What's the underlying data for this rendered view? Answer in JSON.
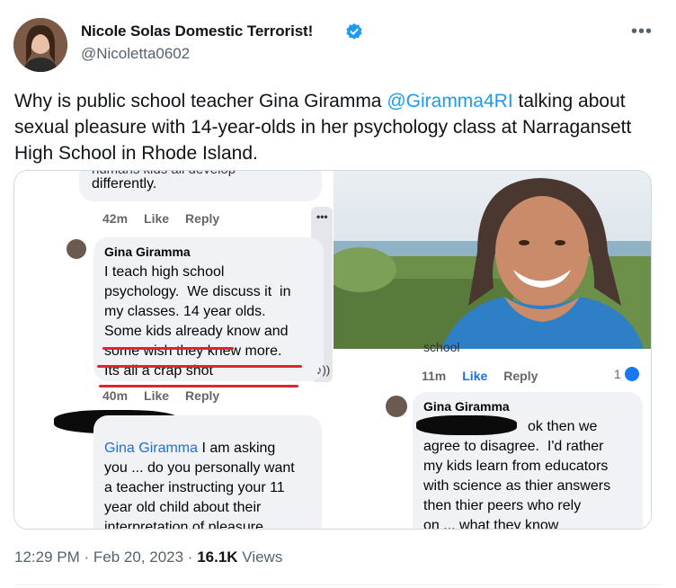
{
  "author": {
    "name": "Nicole Solas Domestic Terrorist!",
    "handle": "@Nicoletta0602"
  },
  "more_label": "•••",
  "tweet": {
    "text_before": "Why is public school teacher Gina Giramma ",
    "mention": "@Giramma4RI",
    "text_after": " talking about sexual pleasure with 14-year-olds in her psychology class at Narragansett High School in Rhode Island."
  },
  "media": {
    "left": {
      "top_partial_line1": "humans kids all develop",
      "top_partial_line2": "differently.",
      "meta1": {
        "time": "42m",
        "like": "Like",
        "reply": "Reply"
      },
      "comment_author": "Gina Giramma",
      "comment_lines": [
        "I teach high school",
        "psychology.  We discuss it  in",
        "my classes. 14 year olds.",
        "Some kids already know and",
        "some wish they knew more.",
        "Its all a crap shot"
      ],
      "meta2": {
        "time": "40m",
        "like": "Like",
        "reply": "Reply"
      },
      "reply_mention": "Gina Giramma",
      "reply_lines": [
        " I am asking",
        "you ... do you personally want",
        "a teacher instructing your 11",
        "year old child about their",
        "interpretation of pleasure"
      ],
      "audio_icon_text": "♪))"
    },
    "right": {
      "partial_top": "school",
      "meta": {
        "time": "11m",
        "like": "Like",
        "reply": "Reply",
        "reaction_count": "1"
      },
      "comment_author": "Gina Giramma",
      "comment_lines": [
        "ok then we",
        "agree to disagree.  I'd rather",
        "my kids learn from educators",
        "with science as thier answers",
        "then thier peers who rely",
        "on ... what they know"
      ]
    }
  },
  "footer": {
    "time": "12:29 PM",
    "sep1": " · ",
    "date": "Feb 20, 2023",
    "sep2": " · ",
    "views_count": "16.1K",
    "views_label": " Views"
  }
}
